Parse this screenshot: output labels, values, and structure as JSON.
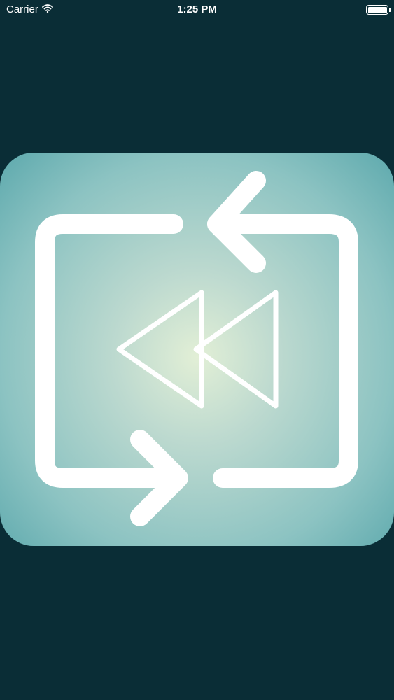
{
  "status_bar": {
    "carrier": "Carrier",
    "time": "1:25 PM",
    "battery_level": 1.0
  },
  "colors": {
    "background": "#0a2d36",
    "tile_center": "#e2efd6",
    "tile_edge": "#5da9ad",
    "glyph": "#ffffff"
  },
  "logo": {
    "icon": "repeat-rewind-icon"
  }
}
